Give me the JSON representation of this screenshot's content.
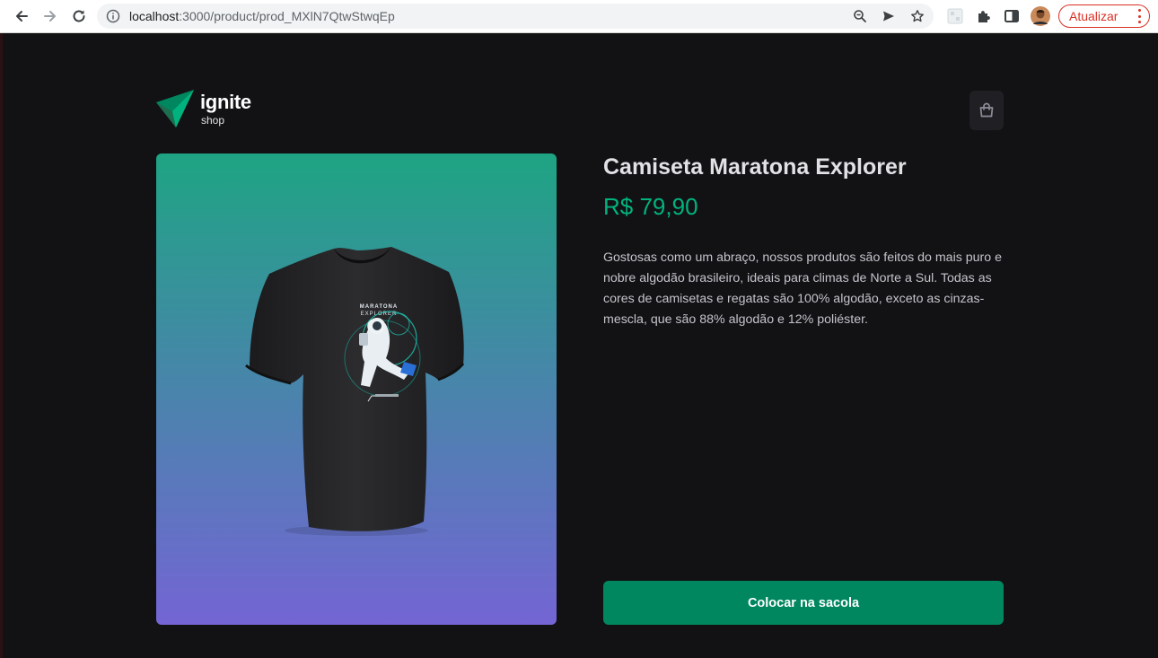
{
  "browser": {
    "url_host": "localhost",
    "url_path": ":3000/product/prod_MXlN7QtwStwqEp",
    "update_label": "Atualizar",
    "icons": [
      "back-icon",
      "forward-icon",
      "reload-icon",
      "info-icon",
      "zoom-icon",
      "send-icon",
      "star-icon",
      "extension-tile-icon",
      "puzzle-icon",
      "sidepanel-icon",
      "profile-avatar",
      "more-vert-icon"
    ]
  },
  "header": {
    "logo_title": "ignite",
    "logo_subtitle": "shop",
    "logo_colors": [
      "#00875f",
      "#1d6d4f",
      "#00b37e"
    ],
    "cart_icon": "handbag-icon"
  },
  "product": {
    "name": "Camiseta Maratona Explorer",
    "price": "R$ 79,90",
    "description": "Gostosas como um abraço, nossos produtos são feitos do mais puro e nobre algodão brasileiro, ideais para climas de Norte a Sul. Todas as cores de camisetas e regatas são 100% algodão, exceto as cinzas-mescla, que são 88% algodão e 12% poliéster.",
    "image_print_title": "MARATONA",
    "image_print_subtitle": "EXPLORER",
    "button_label": "Colocar na sacola"
  },
  "colors": {
    "background": "#121214",
    "price": "#00b37e",
    "button": "#00875f",
    "gradient_top": "#1ea483",
    "gradient_bottom": "#7465d4"
  }
}
